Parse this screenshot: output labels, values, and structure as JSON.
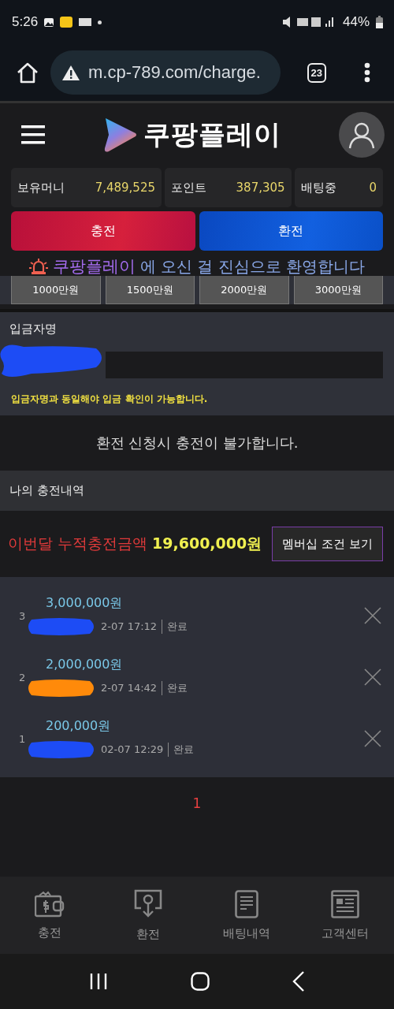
{
  "status_bar": {
    "time": "5:26",
    "battery": "44%"
  },
  "browser": {
    "url": "m.cp-789.com/charge.",
    "tab_count": "23"
  },
  "header": {
    "logo_text": "쿠팡플레이"
  },
  "balances": [
    {
      "label": "보유머니",
      "value": "7,489,525"
    },
    {
      "label": "포인트",
      "value": "387,305"
    },
    {
      "label": "배팅중",
      "value": "0"
    }
  ],
  "actions": [
    {
      "label": "충전",
      "kind": "charge"
    },
    {
      "label": "환전",
      "kind": "exchange"
    }
  ],
  "welcome": {
    "brand": "쿠팡플레이",
    "message": "에 오신 걸 진심으로 환영합니다"
  },
  "amount_buttons": [
    "1000만원",
    "1500만원",
    "2000만원",
    "3000만원"
  ],
  "deposit": {
    "label": "입금자명",
    "hint": "입금자명과 동일해야 입금 확인이 가능합니다."
  },
  "notice": "환전 신청시 충전이 불가합니다.",
  "history": {
    "title": "나의 충전내역",
    "total_label": "이번달 누적충전금액",
    "total_value": "19,600,000원",
    "membership_button": "멤버십 조건 보기"
  },
  "entries": [
    {
      "index": "3",
      "amount": "3,000,000원",
      "time": "2-07 17:12",
      "status": "완료"
    },
    {
      "index": "2",
      "amount": "2,000,000원",
      "time": "2-07 14:42",
      "status": "완료"
    },
    {
      "index": "1",
      "amount": "200,000원",
      "time": "02-07 12:29",
      "status": "완료"
    }
  ],
  "pagination": [
    {
      "label": "1",
      "selected": true
    }
  ],
  "bottom_nav": [
    {
      "label": "충전",
      "kind": "wallet"
    },
    {
      "label": "환전",
      "kind": "withdraw"
    },
    {
      "label": "배팅내역",
      "kind": "document"
    },
    {
      "label": "고객센터",
      "kind": "news"
    }
  ]
}
